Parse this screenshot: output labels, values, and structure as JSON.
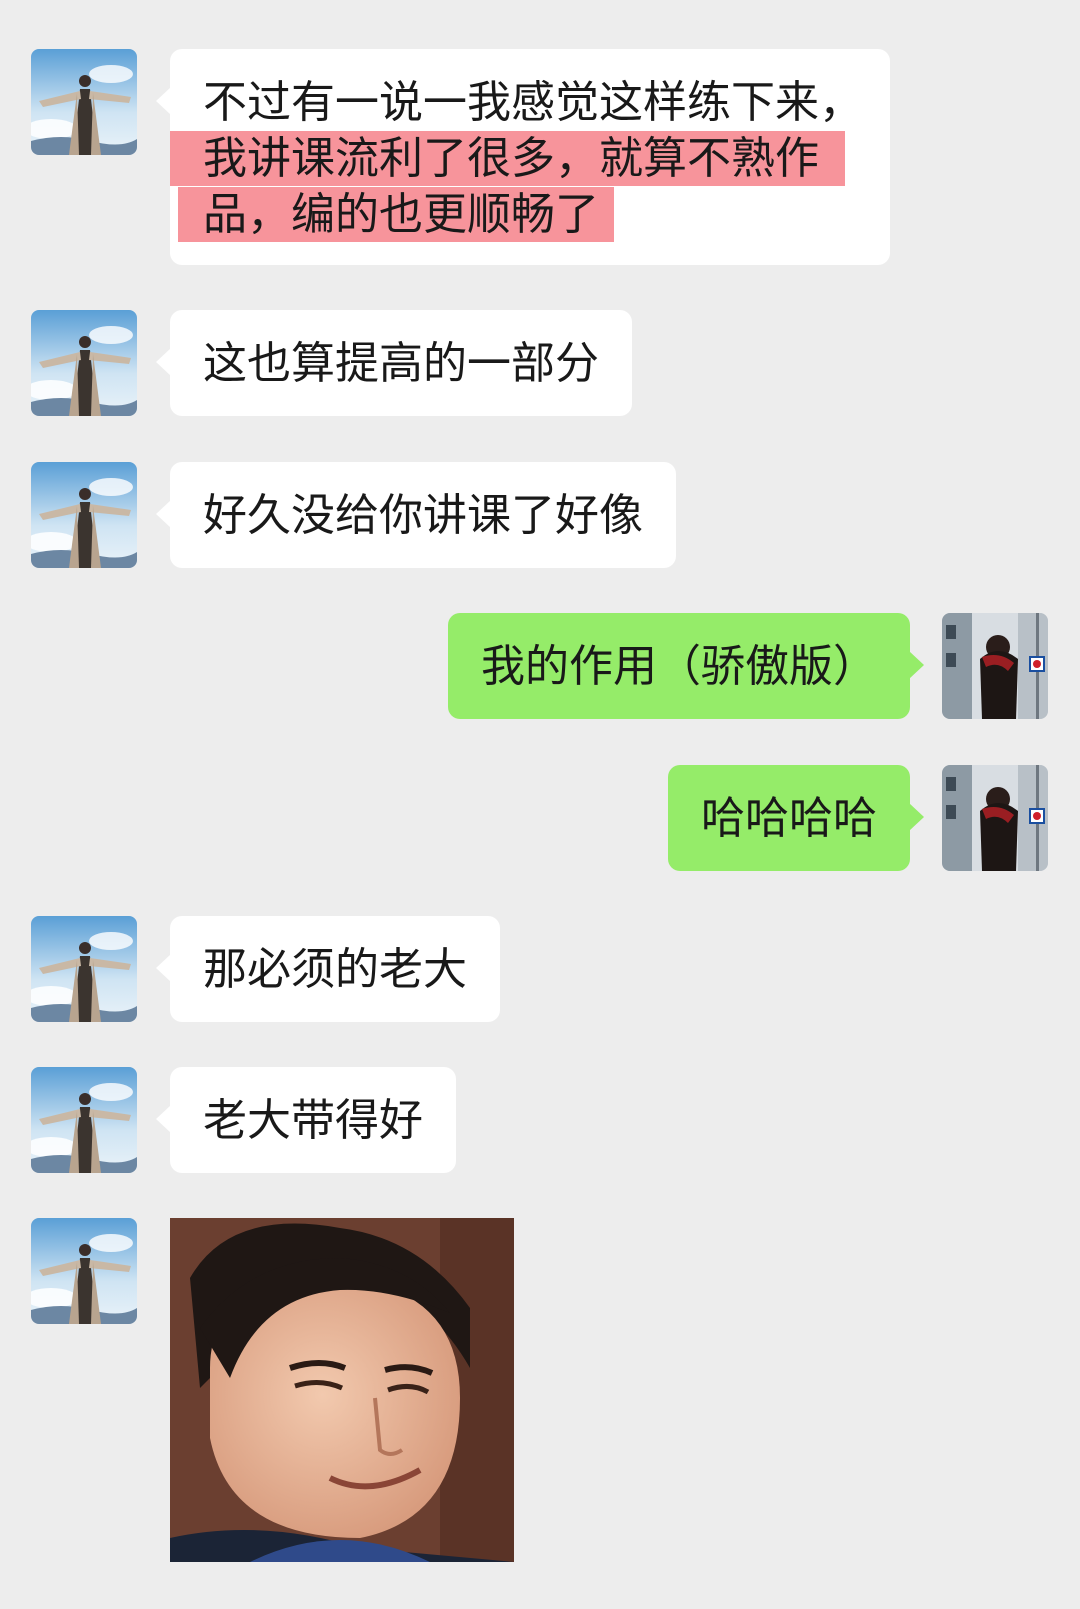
{
  "chat": {
    "messages": [
      {
        "side": "in",
        "lines": [
          {
            "text": "不过有一说一我感觉这样练下来，",
            "highlight": false
          },
          {
            "text": "我讲课流利了很多，就算不熟作",
            "highlight": true
          },
          {
            "text": "品，编的也更顺畅了",
            "highlight": true
          }
        ]
      },
      {
        "side": "in",
        "text": "这也算提高的一部分"
      },
      {
        "side": "in",
        "text": "好久没给你讲课了好像"
      },
      {
        "side": "out",
        "text": "我的作用（骄傲版）"
      },
      {
        "side": "out",
        "text": "哈哈哈哈"
      },
      {
        "side": "in",
        "text": "那必须的老大"
      },
      {
        "side": "in",
        "text": "老大带得好"
      },
      {
        "side": "in",
        "type": "sticker",
        "icon": "smirking-face-sticker"
      }
    ]
  },
  "colors": {
    "background": "#ededed",
    "incoming_bubble": "#ffffff",
    "outgoing_bubble": "#95ec69",
    "highlight": "#f4707a"
  }
}
